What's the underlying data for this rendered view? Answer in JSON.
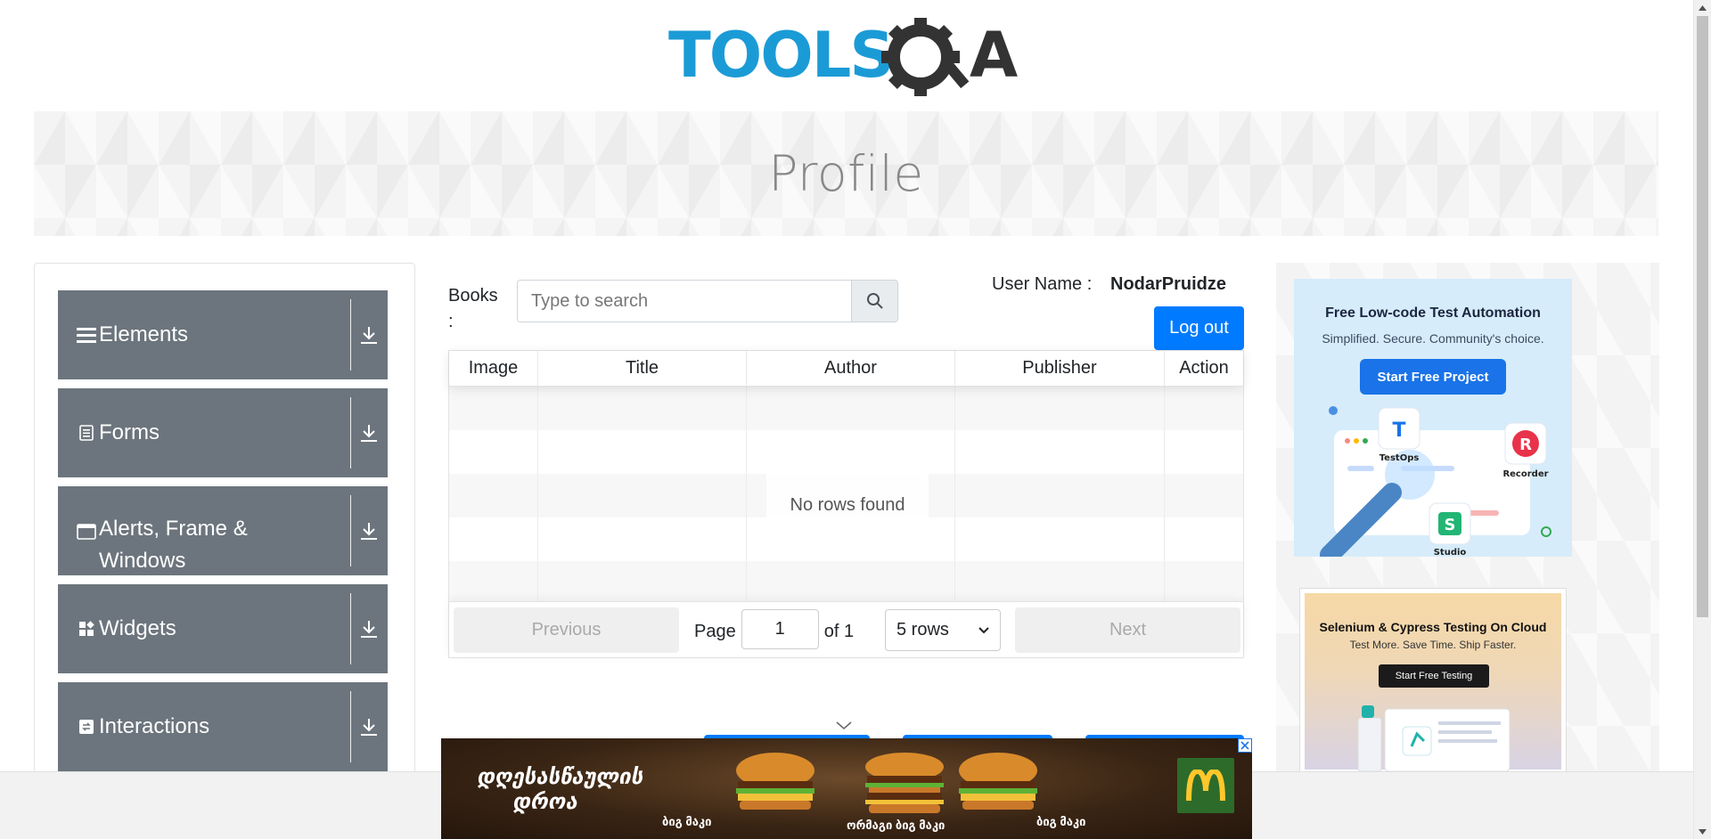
{
  "logo": {
    "text_left": "TOOLS",
    "text_right": "A",
    "alt": "TOOLSQA"
  },
  "banner": {
    "title": "Profile"
  },
  "sidebar": {
    "groups": [
      {
        "label": "Elements",
        "icon": "hamburger-icon"
      },
      {
        "label": "Forms",
        "icon": "document-icon"
      },
      {
        "label": "Alerts, Frame & Windows",
        "icon": "window-icon"
      },
      {
        "label": "Widgets",
        "icon": "widgets-icon"
      },
      {
        "label": "Interactions",
        "icon": "interactions-icon"
      }
    ]
  },
  "books": {
    "label": "Books :",
    "search_placeholder": "Type to search"
  },
  "user": {
    "label": "User Name :",
    "value": "NodarPruidze",
    "logout_label": "Log out"
  },
  "table": {
    "columns": [
      "Image",
      "Title",
      "Author",
      "Publisher",
      "Action"
    ],
    "empty_text": "No rows found",
    "pagination": {
      "previous_label": "Previous",
      "page_label": "Page",
      "page_value": "1",
      "of_label": "of 1",
      "rows_option": "5 rows",
      "next_label": "Next"
    }
  },
  "ads": {
    "ad1": {
      "title": "Free Low-code Test Automation",
      "subtitle": "Simplified. Secure. Community's choice.",
      "cta": "Start Free Project",
      "labels": [
        "TestOps",
        "Recorder",
        "Studio"
      ]
    },
    "ad2": {
      "title": "Selenium & Cypress Testing On Cloud",
      "subtitle": "Test More. Save Time. Ship Faster.",
      "cta": "Start Free Testing"
    },
    "bottom": {
      "headline_1": "დღესასწაულის",
      "headline_2": "დროა",
      "captions": [
        "ბიგ მაკი",
        "ორმაგი ბიგ მაკი",
        "ბიგ მაკი"
      ]
    }
  },
  "colors": {
    "primary": "#007bff",
    "sidebar_group": "#6c757d",
    "logo_blue": "#1b9bd6",
    "logo_dark": "#333333"
  }
}
